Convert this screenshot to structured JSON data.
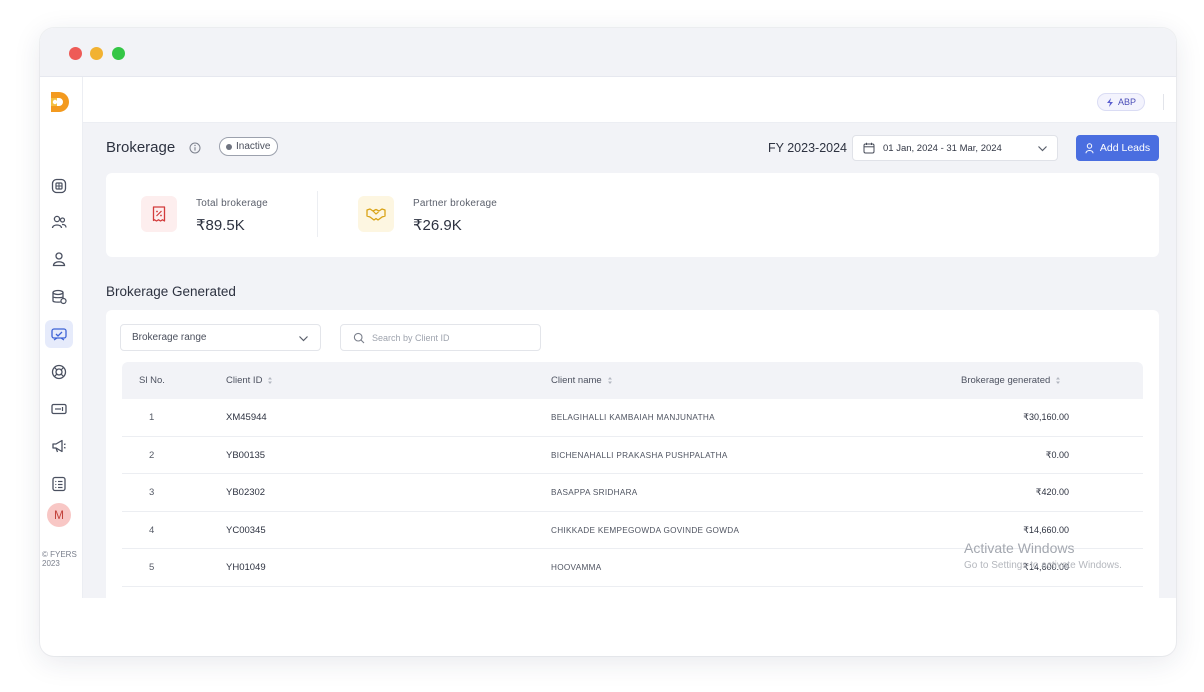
{
  "window": {
    "traffic_lights": [
      "#ee5b57",
      "#f2b232",
      "#34c646"
    ]
  },
  "sidebar": {
    "logo": "fyers-logo",
    "items": [
      {
        "icon": "dashboard-icon",
        "active": false
      },
      {
        "icon": "users-icon",
        "active": false
      },
      {
        "icon": "user-icon",
        "active": false
      },
      {
        "icon": "database-icon",
        "active": false
      },
      {
        "icon": "brokerage-icon",
        "active": true
      },
      {
        "icon": "support-icon",
        "active": false
      },
      {
        "icon": "ticket-icon",
        "active": false
      },
      {
        "icon": "megaphone-icon",
        "active": false
      },
      {
        "icon": "report-icon",
        "active": false
      }
    ],
    "avatar_initial": "M",
    "copyright": "© FYERS 2023"
  },
  "topbar": {
    "chip_label": "ABP"
  },
  "header": {
    "title": "Brokerage",
    "status": "Inactive",
    "fy_label": "FY 2023-2024",
    "date_range": "01 Jan, 2024 - 31 Mar, 2024",
    "add_leads_label": "Add Leads"
  },
  "stats": [
    {
      "label": "Total  brokerage",
      "value": "₹89.5K",
      "icon": "receipt-percent-icon",
      "icon_color": "#d23b3b",
      "bg": "#fdeeee"
    },
    {
      "label": "Partner  brokerage",
      "value": "₹26.9K",
      "icon": "handshake-icon",
      "icon_color": "#d9a316",
      "bg": "#fdf6e1"
    }
  ],
  "section": {
    "title": "Brokerage Generated"
  },
  "filters": {
    "range_label": "Brokerage range",
    "search_placeholder": "Search by Client ID"
  },
  "table": {
    "columns": [
      "Sl No.",
      "Client ID",
      "Client name",
      "Brokerage generated"
    ],
    "rows": [
      {
        "sl": "1",
        "client_id": "XM45944",
        "client_name": "BELAGIHALLI KAMBAIAH MANJUNATHA",
        "brokerage": "₹30,160.00"
      },
      {
        "sl": "2",
        "client_id": "YB00135",
        "client_name": "BICHENAHALLI PRAKASHA PUSHPALATHA",
        "brokerage": "₹0.00"
      },
      {
        "sl": "3",
        "client_id": "YB02302",
        "client_name": "BASAPPA SRIDHARA",
        "brokerage": "₹420.00"
      },
      {
        "sl": "4",
        "client_id": "YC00345",
        "client_name": "CHIKKADE KEMPEGOWDA GOVINDE GOWDA",
        "brokerage": "₹14,660.00"
      },
      {
        "sl": "5",
        "client_id": "YH01049",
        "client_name": "HOOVAMMA",
        "brokerage": "₹14,600.00"
      }
    ]
  },
  "watermark": {
    "line1": "Activate Windows",
    "line2": "Go to Settings to activate Windows."
  },
  "colors": {
    "accent": "#4a6ee0",
    "page_bg": "#f2f3f7"
  }
}
